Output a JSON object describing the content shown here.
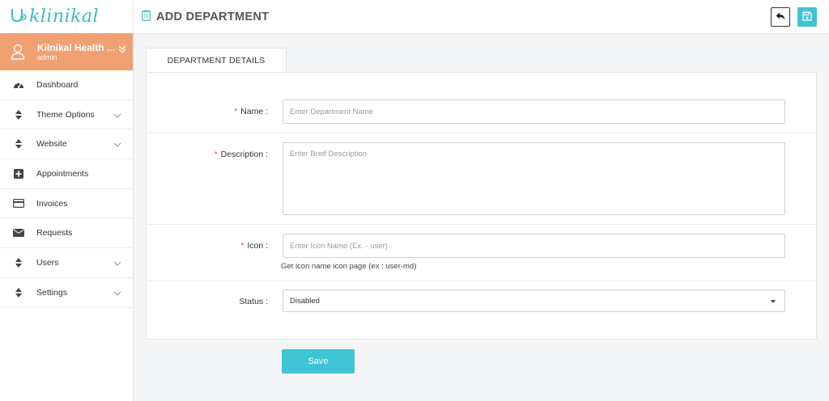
{
  "app": {
    "logo_text": "klinikal"
  },
  "user": {
    "name": "Kilnikal Health ...",
    "role": "admin"
  },
  "sidebar": {
    "items": [
      {
        "label": "Dashboard",
        "icon": "dashboard-icon",
        "has_submenu": false
      },
      {
        "label": "Theme Options",
        "icon": "sort-icon",
        "has_submenu": true
      },
      {
        "label": "Website",
        "icon": "sort-icon",
        "has_submenu": true
      },
      {
        "label": "Appointments",
        "icon": "plus-square-icon",
        "has_submenu": false
      },
      {
        "label": "Invoices",
        "icon": "credit-card-icon",
        "has_submenu": false
      },
      {
        "label": "Requests",
        "icon": "envelope-icon",
        "has_submenu": false
      },
      {
        "label": "Users",
        "icon": "sort-icon",
        "has_submenu": true
      },
      {
        "label": "Settings",
        "icon": "sort-icon",
        "has_submenu": true
      }
    ]
  },
  "header": {
    "title": "ADD DEPARTMENT",
    "title_icon": "clipboard-icon",
    "back_icon": "reply-icon",
    "save_icon": "floppy-disk-icon"
  },
  "tabs": [
    {
      "label": "DEPARTMENT DETAILS",
      "active": true
    }
  ],
  "form": {
    "name": {
      "label": "Name :",
      "required": true,
      "value": "",
      "placeholder": "Enter Department Name"
    },
    "description": {
      "label": "Description :",
      "required": true,
      "value": "",
      "placeholder": "Enter Breif Description"
    },
    "icon": {
      "label": "Icon :",
      "required": true,
      "value": "",
      "placeholder": "Enter Icon Name (Ex. - user)",
      "help": "Get icon name icon page (ex : user-md)"
    },
    "status": {
      "label": "Status :",
      "required": false,
      "selected": "Disabled"
    },
    "required_mark": "*",
    "submit_label": "Save"
  },
  "colors": {
    "accent": "#3fc4d4",
    "user_card": "#f0a071",
    "required": "#e05050"
  }
}
